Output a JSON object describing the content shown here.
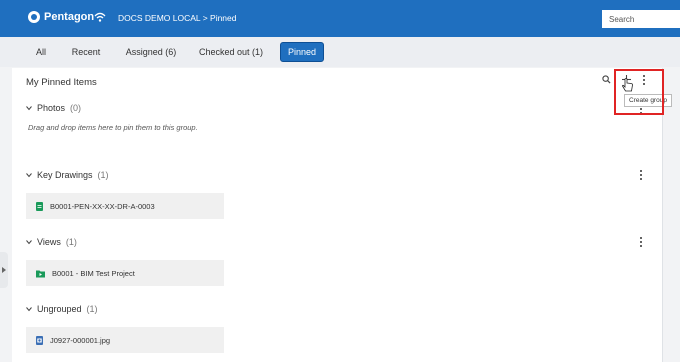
{
  "app": {
    "logo_text": "Pentagon",
    "breadcrumb": "DOCS DEMO LOCAL > Pinned"
  },
  "search": {
    "placeholder": "Search"
  },
  "tabs": [
    {
      "label": "All"
    },
    {
      "label": "Recent"
    },
    {
      "label": "Assigned (6)"
    },
    {
      "label": "Checked out (1)"
    },
    {
      "label": "Pinned",
      "active": true
    }
  ],
  "panel": {
    "title": "My Pinned Items",
    "tooltip": "Create group"
  },
  "groups": {
    "photos": {
      "name": "Photos",
      "count": "(0)",
      "hint": "Drag and drop items here to pin them to this group."
    },
    "key_drawings": {
      "name": "Key Drawings",
      "count": "(1)",
      "items": [
        {
          "label": "B0001-PEN-XX-XX-DR-A-0003"
        }
      ]
    },
    "views": {
      "name": "Views",
      "count": "(1)",
      "items": [
        {
          "label": "B0001 - BIM Test Project"
        }
      ]
    },
    "ungrouped": {
      "name": "Ungrouped",
      "count": "(1)",
      "items": [
        {
          "label": "J0927-000001.jpg"
        }
      ]
    }
  },
  "colors": {
    "brand": "#1f6fbf",
    "highlight": "#e02424",
    "drawing_icon": "#1a9a5a",
    "view_icon": "#1a9a5a",
    "image_icon": "#3b6fb5"
  },
  "icons": [
    "wifi-icon",
    "search-icon",
    "plus-icon",
    "kebab-icon",
    "chevron-down-icon",
    "drawing-file-icon",
    "view-folder-icon",
    "image-file-icon",
    "cursor-icon"
  ]
}
